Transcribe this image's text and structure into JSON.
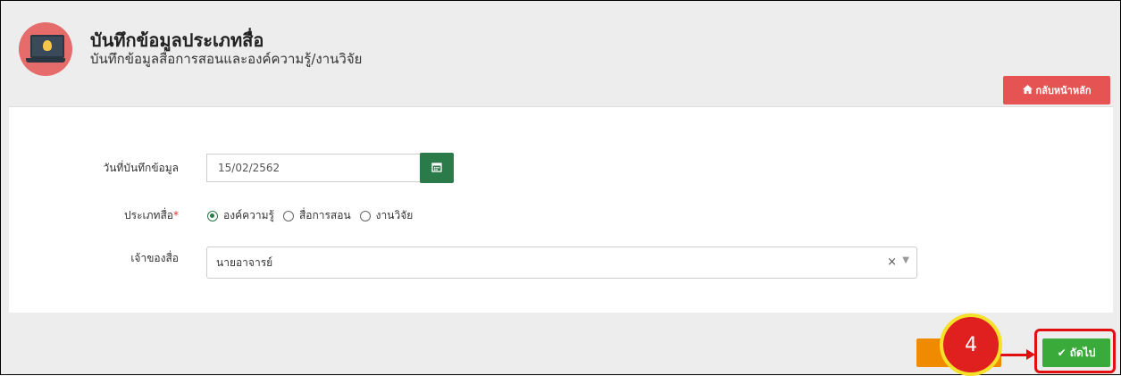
{
  "header": {
    "title": "บันทึกข้อมูลประเภทสื่อ",
    "subtitle": "บันทึกข้อมูลสื่อการสอนและองค์ความรู้/งานวิจัย",
    "icon": "laptop-lightbulb-icon",
    "icon_color": "#e66b6b"
  },
  "toolbar": {
    "home_label": "กลับหน้าหลัก",
    "home_icon": "home-icon",
    "home_color": "#e55353"
  },
  "form": {
    "date_label": "วันที่บันทึกข้อมูล",
    "date_value": "15/02/2562",
    "type_label": "ประเภทสื่อ",
    "required_mark": "*",
    "type_options": [
      "องค์ความรู้",
      "สื่อการสอน",
      "งานวิจัย"
    ],
    "type_selected": "องค์ความรู้",
    "owner_label": "เจ้าของสื่อ",
    "owner_value": "นายอาจารย์"
  },
  "footer": {
    "next_label": "ถัดไป",
    "next_color": "#3aaa3a",
    "back_color": "#f08a00"
  },
  "annotation": {
    "step_number": "4",
    "highlight_color": "#e01010"
  }
}
